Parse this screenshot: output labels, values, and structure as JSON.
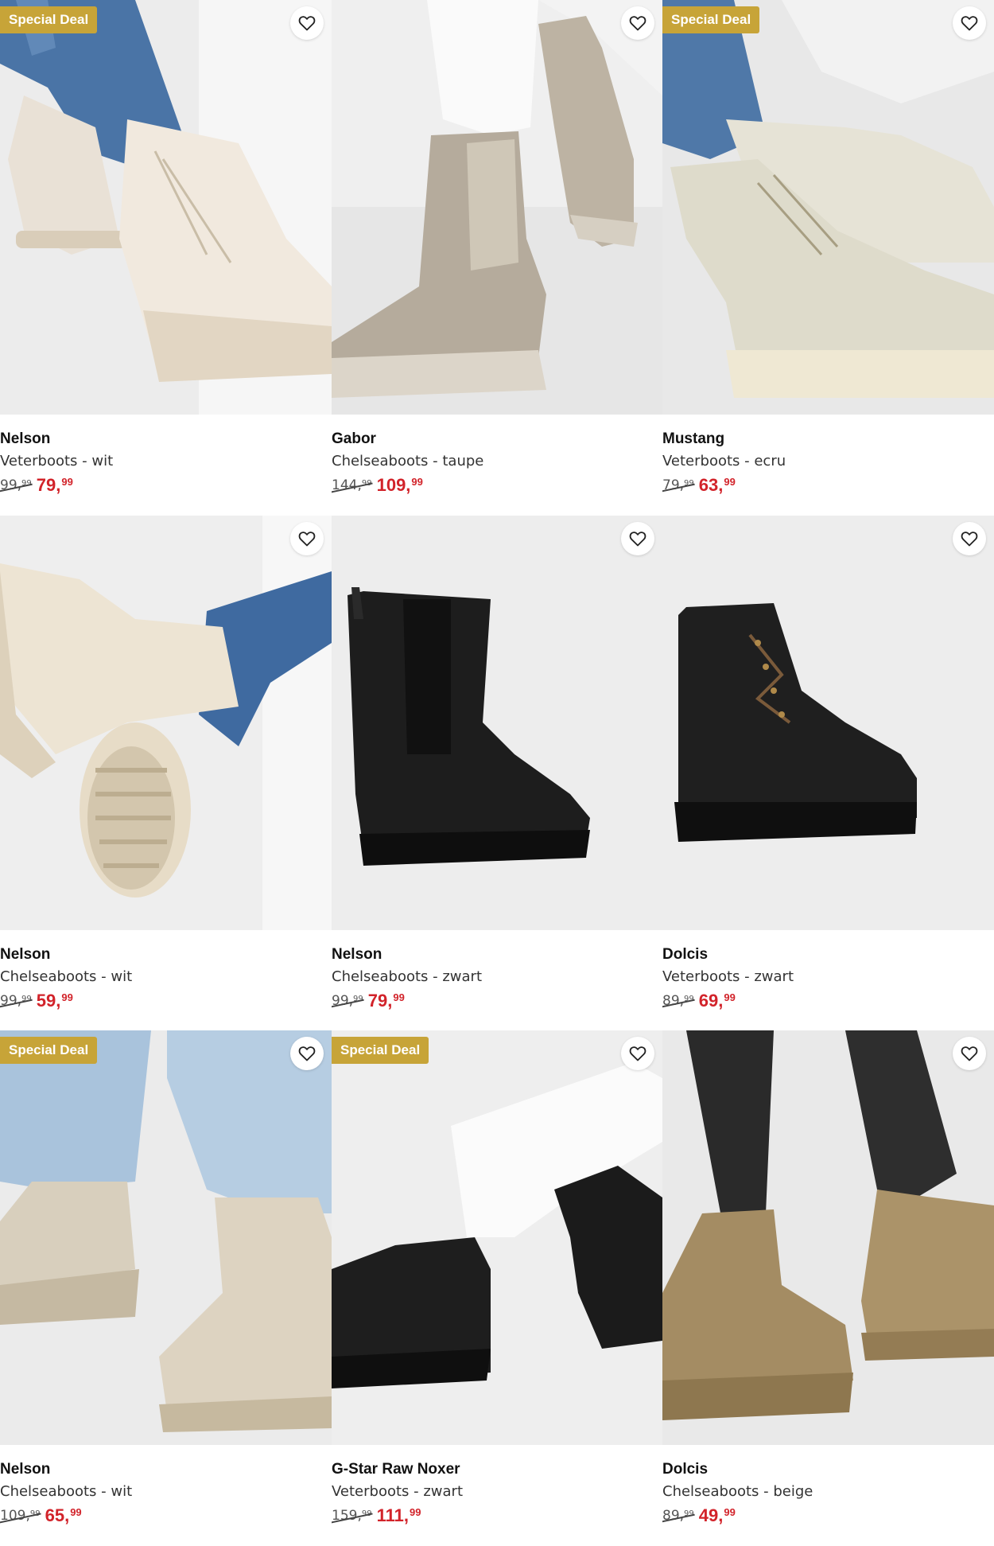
{
  "ui": {
    "badge_color": "#c7a438",
    "sale_price_color": "#d2232a",
    "favorite_icon": "heart-outline-icon"
  },
  "products": [
    {
      "badge": "Special Deal",
      "brand": "Nelson",
      "description": "Veterboots - wit",
      "old_price": {
        "whole": "99,",
        "cents": "99"
      },
      "new_price": {
        "whole": "79,",
        "cents": "99"
      },
      "image": "off-white lace-up boots on model in jeans"
    },
    {
      "badge": "",
      "brand": "Gabor",
      "description": "Chelseaboots - taupe",
      "old_price": {
        "whole": "144,",
        "cents": "99"
      },
      "new_price": {
        "whole": "109,",
        "cents": "99"
      },
      "image": "taupe suede chelsea boots on model in white trousers"
    },
    {
      "badge": "Special Deal",
      "brand": "Mustang",
      "description": "Veterboots - ecru",
      "old_price": {
        "whole": "79,",
        "cents": "99"
      },
      "new_price": {
        "whole": "63,",
        "cents": "99"
      },
      "image": "ecru lace-up boots on model in jeans"
    },
    {
      "badge": "",
      "brand": "Nelson",
      "description": "Chelseaboots - wit",
      "old_price": {
        "whole": "99,",
        "cents": "99"
      },
      "new_price": {
        "whole": "59,",
        "cents": "99"
      },
      "image": "off-white chelsea boots with chunky sole"
    },
    {
      "badge": "",
      "brand": "Nelson",
      "description": "Chelseaboots - zwart",
      "old_price": {
        "whole": "99,",
        "cents": "99"
      },
      "new_price": {
        "whole": "79,",
        "cents": "99"
      },
      "image": "black leather chelsea boot packshot"
    },
    {
      "badge": "",
      "brand": "Dolcis",
      "description": "Veterboots - zwart",
      "old_price": {
        "whole": "89,",
        "cents": "99"
      },
      "new_price": {
        "whole": "69,",
        "cents": "99"
      },
      "image": "black leather lace-up boot packshot"
    },
    {
      "badge": "Special Deal",
      "brand": "Nelson",
      "description": "Chelseaboots - wit",
      "old_price": {
        "whole": "109,",
        "cents": "99"
      },
      "new_price": {
        "whole": "65,",
        "cents": "99"
      },
      "image": "beige suede chelsea boots on model in light jeans"
    },
    {
      "badge": "Special Deal",
      "brand": "G-Star Raw Noxer",
      "description": "Veterboots - zwart",
      "old_price": {
        "whole": "159,",
        "cents": "99"
      },
      "new_price": {
        "whole": "111,",
        "cents": "99"
      },
      "image": "black suede lace-up boots on model in white jeans"
    },
    {
      "badge": "",
      "brand": "Dolcis",
      "description": "Chelseaboots - beige",
      "old_price": {
        "whole": "89,",
        "cents": "99"
      },
      "new_price": {
        "whole": "49,",
        "cents": "99"
      },
      "image": "beige suede chelsea boots on model in black tights"
    }
  ]
}
